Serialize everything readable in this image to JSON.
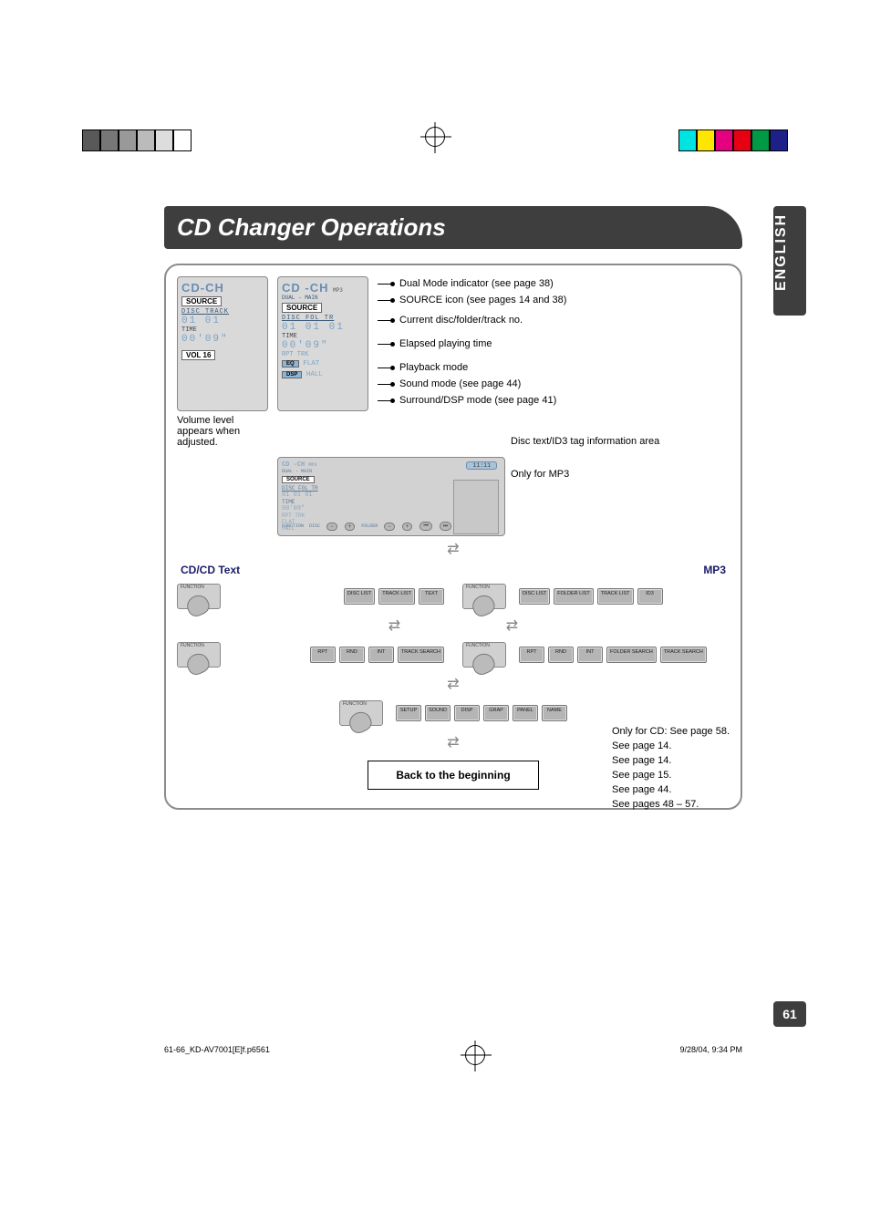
{
  "title": "CD Changer Operations",
  "side_tab": "ENGLISH",
  "page_number": "61",
  "screens": {
    "left": {
      "logo": "CD-CH",
      "source": "SOURCE",
      "headers": "DISC   TRACK",
      "nums": "01    01",
      "time_label": "TIME",
      "time_val": "00'09\"",
      "vol": "VOL 16"
    },
    "right": {
      "logo": "CD -CH",
      "sub": "MP3",
      "dual": "DUAL - MAIN",
      "source": "SOURCE",
      "headers": "DISC FOL  TR",
      "nums": "01  01  01",
      "time_label": "TIME",
      "time_val": "00'09\"",
      "rpt": "RPT  TRK",
      "flat": "FLAT",
      "hall": "HALL"
    }
  },
  "vol_caption": "Volume level appears when adjusted.",
  "callouts": {
    "dual": "Dual Mode indicator (see page 38)",
    "source_icon": "SOURCE icon (see pages 14 and 38)",
    "current": "Current disc/folder/track no.",
    "elapsed": "Elapsed playing time",
    "playback": "Playback mode",
    "sound": "Sound mode (see page 44)",
    "surround": "Surround/DSP mode (see page 41)"
  },
  "small_screen": {
    "time": "11:11",
    "function": "FUNCTION",
    "disc_label": "DISC",
    "folder_label": "FOLDER"
  },
  "small_callouts": {
    "disc_text": "Disc text/ID3 tag information area",
    "mp3only": "Only for MP3"
  },
  "section": {
    "left": "CD/CD Text",
    "right": "MP3"
  },
  "function_label": "FUNCTION",
  "funcbars": {
    "row1_left": [
      "DISC\nLIST",
      "TRACK\nLIST",
      "TEXT"
    ],
    "row1_right": [
      "DISC\nLIST",
      "FOLDER\nLIST",
      "TRACK\nLIST",
      "ID3"
    ],
    "row2_left": [
      "RPT",
      "RND",
      "INT",
      "TRACK\nSEARCH"
    ],
    "row2_right": [
      "RPT",
      "RND",
      "INT",
      "FOLDER\nSEARCH",
      "TRACK\nSEARCH"
    ],
    "row3": [
      "SETUP",
      "SOUND",
      "DISP",
      "GRAP",
      "PANEL",
      "NAME"
    ]
  },
  "sidenotes": [
    "Only for CD: See page 58.",
    "See page 14.",
    "See page 14.",
    "See page 15.",
    "See page 44.",
    "See pages 48 – 57."
  ],
  "back_text": "Back to the beginning",
  "footer": {
    "file": "61-66_KD-AV7001[E]f.p65",
    "page": "61",
    "date": "9/28/04, 9:34 PM"
  }
}
